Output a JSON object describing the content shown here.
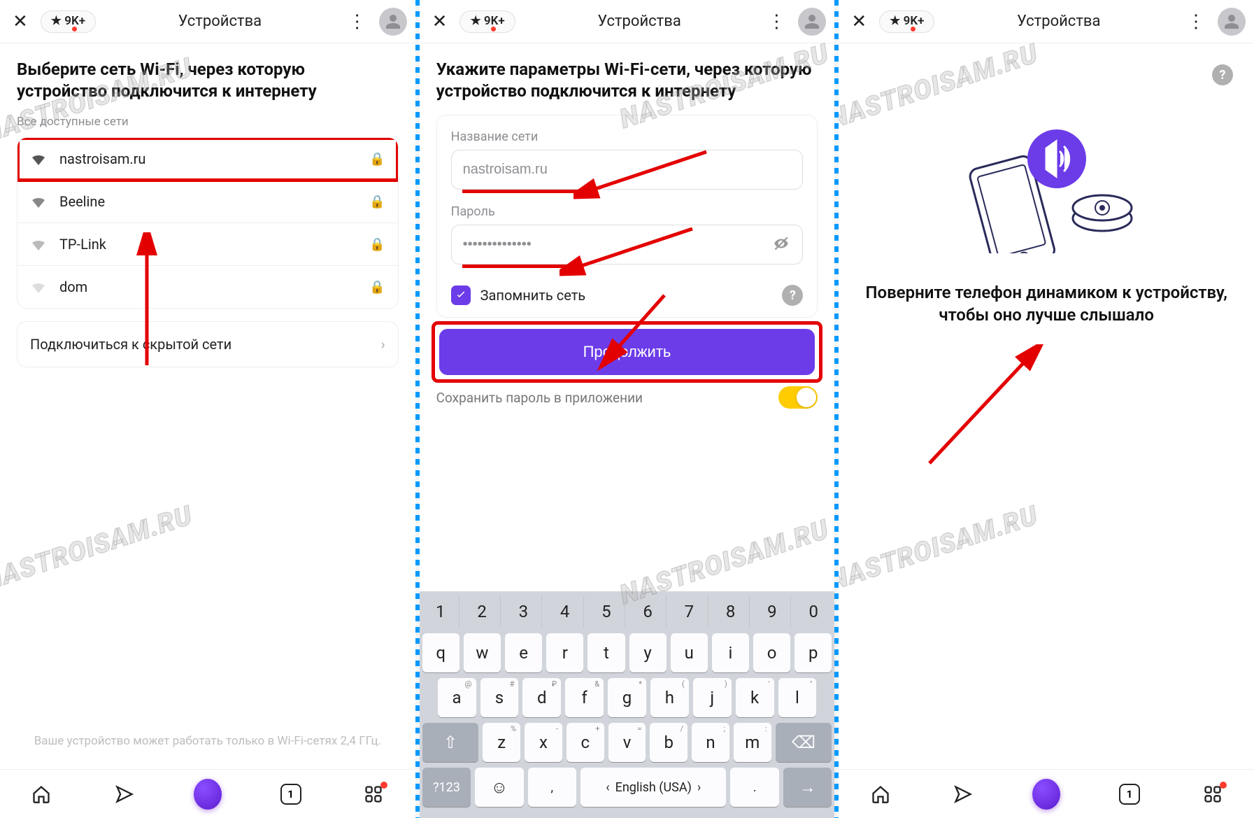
{
  "watermark": "NASTROISAM.RU",
  "topbar": {
    "rating": "★ 9K+",
    "title": "Устройства"
  },
  "panel1": {
    "heading": "Выберите сеть Wi-Fi, через которую устройство подключится к интернету",
    "all_networks_label": "Все доступные сети",
    "networks": [
      {
        "name": "nastroisam.ru",
        "signal": "strong",
        "locked": true,
        "highlight": true
      },
      {
        "name": "Beeline",
        "signal": "strong",
        "locked": true
      },
      {
        "name": "TP-Link",
        "signal": "medium",
        "locked": true
      },
      {
        "name": "dom",
        "signal": "weak",
        "locked": true
      }
    ],
    "hidden_network_label": "Подключиться к скрытой сети",
    "footnote": "Ваше устройство может работать только в Wi-Fi-сетях 2,4 ГГц."
  },
  "panel2": {
    "heading": "Укажите параметры Wi-Fi-сети, через которую устройство подключится к интернету",
    "ssid_label": "Название сети",
    "ssid_value": "nastroisam.ru",
    "password_label": "Пароль",
    "password_value": "••••••••••••••",
    "remember_label": "Запомнить сеть",
    "remember_checked": true,
    "continue_label": "Продолжить",
    "save_password_label": "Сохранить пароль в приложении",
    "save_password_on": true,
    "keyboard": {
      "num_row": [
        "1",
        "2",
        "3",
        "4",
        "5",
        "6",
        "7",
        "8",
        "9",
        "0"
      ],
      "row1": [
        "q",
        "w",
        "e",
        "r",
        "t",
        "y",
        "u",
        "i",
        "o",
        "p"
      ],
      "row2": [
        "a",
        "s",
        "d",
        "f",
        "g",
        "h",
        "j",
        "k",
        "l"
      ],
      "row2_sup": [
        "@",
        "#",
        "₽",
        "&",
        "*",
        "(",
        ")",
        "'",
        "\""
      ],
      "row3": [
        "z",
        "x",
        "c",
        "v",
        "b",
        "n",
        "m"
      ],
      "row3_sup": [
        "%",
        "-",
        "+",
        "=",
        "/",
        ";",
        ":"
      ],
      "shift": "⇧",
      "backspace": "⌫",
      "sym": "?123",
      "emoji": "☺",
      "comma": ",",
      "lang_label": "English (USA)",
      "period": ".",
      "enter": "→"
    }
  },
  "panel3": {
    "instruction": "Поверните телефон динамиком к устройству, чтобы оно лучше слышало"
  },
  "bottomnav": {
    "tab_count": "1"
  }
}
